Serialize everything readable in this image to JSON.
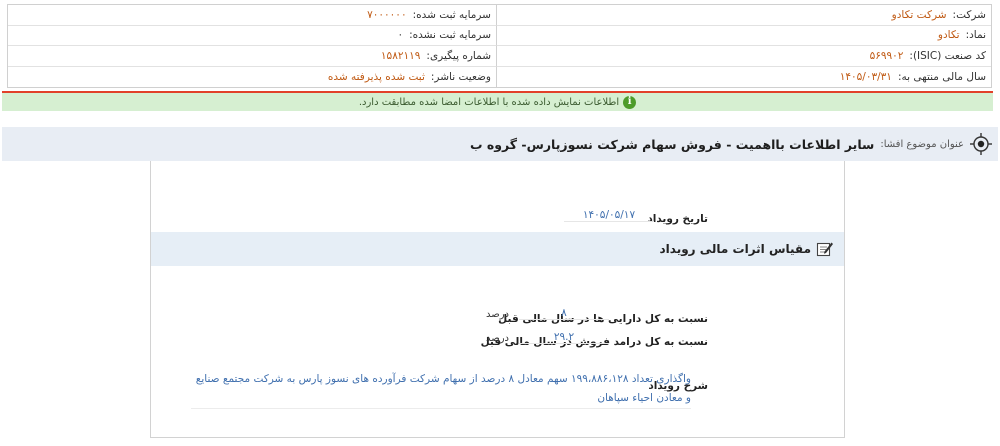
{
  "info": {
    "company_label": "شرکت:",
    "company_value": "شرکت تکادو",
    "symbol_label": "نماد:",
    "symbol_value": "تکادو",
    "isic_label": "کد صنعت (ISIC):",
    "isic_value": "۵۶۹۹۰۲",
    "fiscal_label": "سال مالی منتهی به:",
    "fiscal_value": "۱۴۰۵/۰۳/۳۱",
    "capital_reg_label": "سرمایه ثبت شده:",
    "capital_reg_value": "۷۰۰۰۰۰۰",
    "capital_unreg_label": "سرمایه ثبت نشده:",
    "capital_unreg_value": "۰",
    "tracking_label": "شماره پیگیری:",
    "tracking_value": "۱۵۸۲۱۱۹",
    "status_label": "وضعیت ناشر:",
    "status_value": "ثبت شده پذیرفته شده"
  },
  "alert": {
    "text": "اطلاعات نمایش داده شده با اطلاعات امضا شده مطابقت دارد.",
    "icon": "info-icon",
    "color": "#4d9b2a"
  },
  "subject": {
    "label": "عنوان موضوع افشا:",
    "title": "سایر اطلاعات بااهمیت - فروش سهام شرکت نسوزپارس- گروه ب"
  },
  "event": {
    "date_label": "تاریخ رویداد",
    "date_value": "۱۴۰۵/۰۵/۱۷"
  },
  "section": {
    "title": "مقیاس اثرات مالی رویداد",
    "icon": "edit-icon"
  },
  "metrics": [
    {
      "label": "نسبت به کل دارایی ها در سال مالی قبل",
      "value": "۸",
      "unit": "درصد"
    },
    {
      "label": "نسبت به کل درامد فروش در سال مالی قبل",
      "value": "۲۹.۲",
      "unit": "درصد"
    }
  ],
  "description": {
    "label": "شرح رویداد",
    "value": "واگذاری تعداد ۱۹۹،۸۸۶،۱۲۸ سهم معادل ۸ درصد از سهام شرکت فرآورده های نسوز پارس به شرکت مجتمع صنایع و معادن احیاء سپاهان"
  }
}
